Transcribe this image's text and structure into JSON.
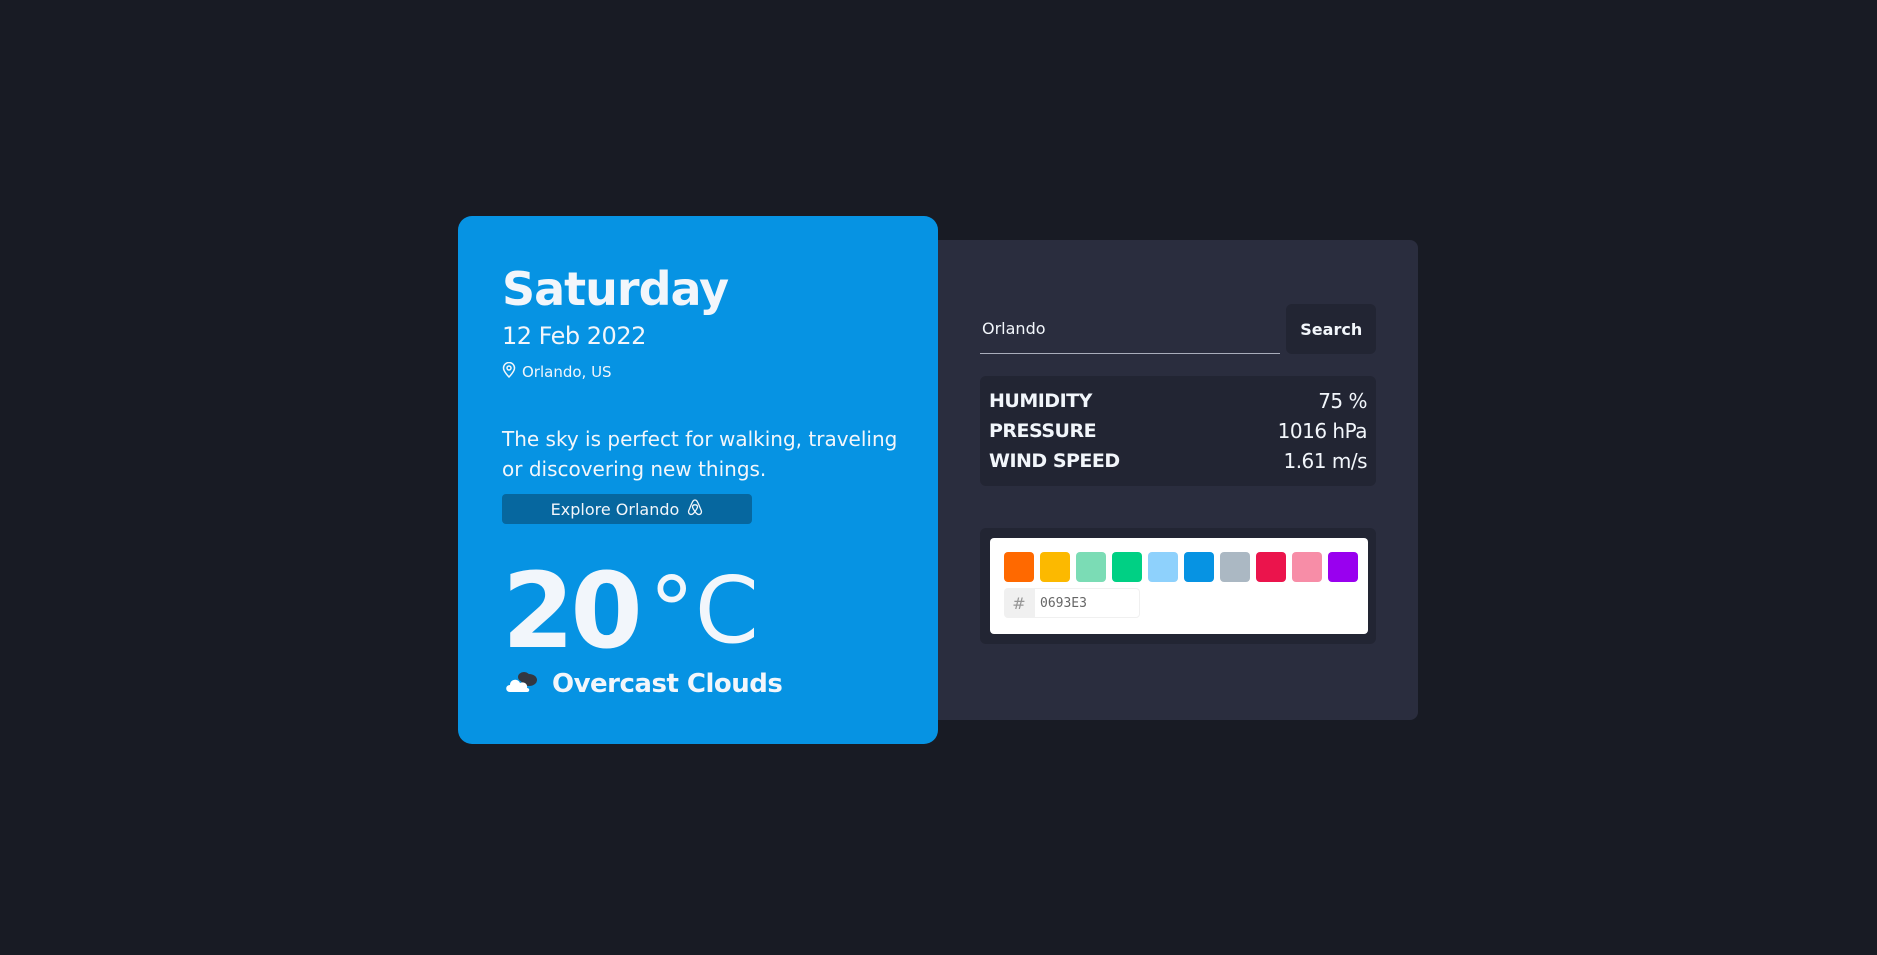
{
  "weather": {
    "day": "Saturday",
    "date": "12 Feb 2022",
    "location": "Orlando, US",
    "tagline": "The sky is perfect for walking, traveling or discovering new things.",
    "explore_label": "Explore Orlando",
    "temperature": "20",
    "unit": "°C",
    "condition": "Overcast Clouds",
    "icons": {
      "location": "map-pin-icon",
      "explore": "airbnb-icon",
      "condition": "cloud-icon"
    }
  },
  "search": {
    "value": "Orlando",
    "button_label": "Search"
  },
  "stats": {
    "humidity_label": "HUMIDITY",
    "humidity_value": "75 %",
    "pressure_label": "PRESSURE",
    "pressure_value": "1016 hPa",
    "wind_label": "WIND SPEED",
    "wind_value": "1.61 m/s"
  },
  "color_picker": {
    "swatches": [
      "#FF6900",
      "#FCB900",
      "#7BDCB5",
      "#00D084",
      "#8ED1FC",
      "#0693E3",
      "#ABB8C3",
      "#EB144C",
      "#F78DA7",
      "#9900EF"
    ],
    "hash_symbol": "#",
    "hex_value": "0693E3"
  },
  "colors": {
    "background": "#181b24",
    "card": "#0693e3",
    "panel": "#2a2d3e",
    "panel_inner": "#222533",
    "explore_button": "#06679f"
  }
}
